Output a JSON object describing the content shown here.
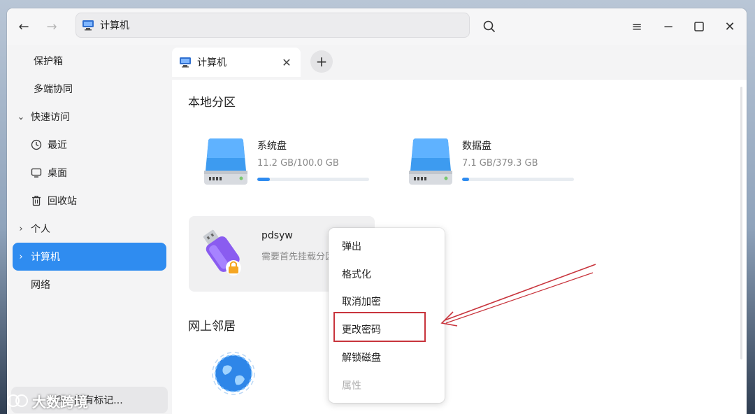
{
  "window": {
    "address_text": "计算机",
    "icons": {
      "back": "arrow-left-icon",
      "forward": "arrow-right-icon",
      "search": "search-icon",
      "menu": "hamburger-icon",
      "minimize": "minimize-icon",
      "maximize": "maximize-icon",
      "close": "close-icon"
    }
  },
  "sidebar": {
    "items": [
      {
        "label": "保护箱",
        "level": 0
      },
      {
        "label": "多端协同",
        "level": 0
      },
      {
        "label": "快速访问",
        "level": 0,
        "chevron": "⌄"
      },
      {
        "label": "最近",
        "level": 1,
        "icon": "clock-icon"
      },
      {
        "label": "桌面",
        "level": 1,
        "icon": "desktop-icon"
      },
      {
        "label": "回收站",
        "level": 1,
        "icon": "trash-icon"
      },
      {
        "label": "个人",
        "level": 0,
        "chevron": "›"
      },
      {
        "label": "计算机",
        "level": 0,
        "chevron": "›",
        "active": true
      },
      {
        "label": "网络",
        "level": 0
      }
    ],
    "tags_label": "所有标记..."
  },
  "tabs": [
    {
      "label": "计算机"
    }
  ],
  "main": {
    "local_section": "本地分区",
    "disks": [
      {
        "name": "系统盘",
        "size": "11.2 GB/100.0 GB",
        "usage": 0.112
      },
      {
        "name": "数据盘",
        "size": "7.1 GB/379.3 GB",
        "usage": 0.019
      }
    ],
    "usb": {
      "name": "pdsyw",
      "note": "需要首先挂载分区"
    },
    "network_section": "网上邻居"
  },
  "context_menu": {
    "items": [
      {
        "label": "弹出",
        "enabled": true
      },
      {
        "label": "格式化",
        "enabled": true
      },
      {
        "label": "取消加密",
        "enabled": true
      },
      {
        "label": "更改密码",
        "enabled": true,
        "highlighted": true
      },
      {
        "label": "解锁磁盘",
        "enabled": true
      },
      {
        "label": "属性",
        "enabled": false
      }
    ]
  },
  "watermark": "大数跨境",
  "colors": {
    "accent": "#2f8cf0",
    "annotation": "#c8343c",
    "lock": "#f5a623",
    "usb_body": "#8a5cf0"
  }
}
